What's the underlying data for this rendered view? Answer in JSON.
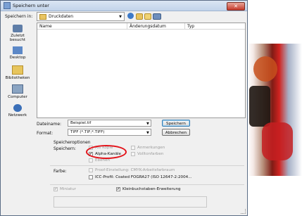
{
  "window": {
    "title": "Speichern unter",
    "close_glyph": "✕"
  },
  "location": {
    "label": "Speichern in:",
    "current_folder": "Druckdaten",
    "arrow": "▼"
  },
  "places": [
    {
      "label": "Zuletzt besucht",
      "icon": "recent-places-icon"
    },
    {
      "label": "Desktop",
      "icon": "desktop-icon"
    },
    {
      "label": "Bibliotheken",
      "icon": "libraries-icon"
    },
    {
      "label": "Computer",
      "icon": "computer-icon"
    },
    {
      "label": "Netzwerk",
      "icon": "network-icon"
    }
  ],
  "filelist": {
    "columns": [
      "Name",
      "Änderungsdatum",
      "Typ"
    ]
  },
  "filename": {
    "label": "Dateiname:",
    "value": "Beispiel.tif",
    "arrow": "▼"
  },
  "format": {
    "label": "Format:",
    "value": "TIFF (*.TIF;*.TIFF)",
    "arrow": "▼"
  },
  "buttons": {
    "save": "Speichern",
    "cancel": "Abbrechen"
  },
  "options": {
    "title": "Speicheroptionen",
    "save_label": "Speichern:",
    "as_copy": {
      "label": "Als Kopie",
      "checked": false,
      "enabled": false
    },
    "alpha_channels": {
      "label": "Alpha-Kanäle",
      "checked": true,
      "enabled": true
    },
    "layers": {
      "label": "Ebenen",
      "checked": false,
      "enabled": false
    },
    "notes": {
      "label": "Anmerkungen",
      "checked": false,
      "enabled": false
    },
    "spot_colors": {
      "label": "Volltonfarben",
      "checked": false,
      "enabled": false
    },
    "color_label": "Farbe:",
    "proof": {
      "label": "Proof-Einstellung: CMYK-Arbeitsfarbraum",
      "checked": false,
      "enabled": false
    },
    "icc": {
      "label": "ICC-Profil: Coated FOGRA27 (ISO 12647-2:2004...",
      "checked": false,
      "enabled": true
    },
    "thumbnail": {
      "label": "Miniatur",
      "checked": true,
      "enabled": false
    },
    "lowercase_ext": {
      "label": "Kleinbuchstaben-Erweiterung",
      "checked": true,
      "enabled": true
    }
  },
  "colors": {
    "highlight": "#e3141b",
    "title_bar": "#c1d3ea",
    "dialog_bg": "#f0f0f0"
  }
}
